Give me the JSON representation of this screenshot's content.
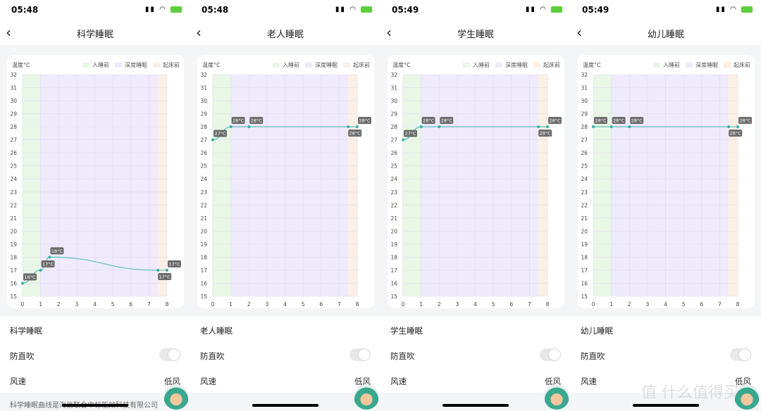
{
  "colors": {
    "line": "#5bbfba",
    "point": "#3aaea6",
    "pre_sleep": "#e9f7e6",
    "deep_sleep": "#efeafc",
    "pre_wake": "#fcefe4",
    "label_bg": "#6b6b6b"
  },
  "panels": [
    {
      "status_time": "05:48",
      "title": "科学睡眠",
      "unit_label": "温度°C",
      "legend": [
        "入睡前",
        "深度睡眠",
        "起床前"
      ],
      "mode_label": "科学睡眠",
      "anti_blow_label": "防直吹",
      "anti_blow_on": false,
      "wind_label": "风速",
      "wind_value": "低风",
      "footnote": "科学睡眠曲线是海信联合中标能效科技有限公司",
      "chart_data": {
        "type": "line",
        "x": [
          0,
          1,
          1.5,
          7.5,
          8
        ],
        "y": [
          16,
          17,
          18,
          17,
          17
        ],
        "point_labels": [
          "16°C",
          "17°C",
          "18°C",
          "17°C",
          "17°C"
        ],
        "xlim": [
          0,
          8
        ],
        "ylim": [
          15,
          32
        ],
        "xticks": [
          0,
          1,
          2,
          3,
          4,
          5,
          6,
          7,
          8
        ],
        "yticks": [
          15,
          16,
          17,
          18,
          19,
          20,
          21,
          22,
          23,
          24,
          25,
          26,
          27,
          28,
          29,
          30,
          31,
          32
        ],
        "bands": [
          {
            "name": "入睡前",
            "from": 0,
            "to": 1
          },
          {
            "name": "深度睡眠",
            "from": 1,
            "to": 7.5
          },
          {
            "name": "起床前",
            "from": 7.5,
            "to": 8
          }
        ],
        "grid": true,
        "legend": "top-right"
      }
    },
    {
      "status_time": "05:48",
      "title": "老人睡眠",
      "unit_label": "温度°C",
      "legend": [
        "入睡前",
        "深度睡眠",
        "起床前"
      ],
      "mode_label": "老人睡眠",
      "anti_blow_label": "防直吹",
      "anti_blow_on": false,
      "wind_label": "风速",
      "wind_value": "低风",
      "chart_data": {
        "type": "line",
        "x": [
          0,
          1,
          2,
          7.5,
          8
        ],
        "y": [
          27,
          28,
          28,
          28,
          28
        ],
        "point_labels": [
          "27°C",
          "28°C",
          "28°C",
          "28°C",
          "28°C"
        ],
        "xlim": [
          0,
          8
        ],
        "ylim": [
          15,
          32
        ],
        "xticks": [
          0,
          1,
          2,
          3,
          4,
          5,
          6,
          7,
          8
        ],
        "yticks": [
          15,
          16,
          17,
          18,
          19,
          20,
          21,
          22,
          23,
          24,
          25,
          26,
          27,
          28,
          29,
          30,
          31,
          32
        ],
        "bands": [
          {
            "name": "入睡前",
            "from": 0,
            "to": 1
          },
          {
            "name": "深度睡眠",
            "from": 1,
            "to": 7.5
          },
          {
            "name": "起床前",
            "from": 7.5,
            "to": 8
          }
        ],
        "grid": true,
        "legend": "top-right"
      }
    },
    {
      "status_time": "05:49",
      "title": "学生睡眠",
      "unit_label": "温度°C",
      "legend": [
        "入睡前",
        "深度睡眠",
        "起床前"
      ],
      "mode_label": "学生睡眠",
      "anti_blow_label": "防直吹",
      "anti_blow_on": false,
      "wind_label": "风速",
      "wind_value": "低风",
      "chart_data": {
        "type": "line",
        "x": [
          0,
          1,
          2,
          7.5,
          8
        ],
        "y": [
          27,
          28,
          28,
          28,
          28
        ],
        "point_labels": [
          "27°C",
          "28°C",
          "28°C",
          "28°C",
          "28°C"
        ],
        "xlim": [
          0,
          8
        ],
        "ylim": [
          15,
          32
        ],
        "xticks": [
          0,
          1,
          2,
          3,
          4,
          5,
          6,
          7,
          8
        ],
        "yticks": [
          15,
          16,
          17,
          18,
          19,
          20,
          21,
          22,
          23,
          24,
          25,
          26,
          27,
          28,
          29,
          30,
          31,
          32
        ],
        "bands": [
          {
            "name": "入睡前",
            "from": 0,
            "to": 1
          },
          {
            "name": "深度睡眠",
            "from": 1,
            "to": 7.5
          },
          {
            "name": "起床前",
            "from": 7.5,
            "to": 8
          }
        ],
        "grid": true,
        "legend": "top-right"
      }
    },
    {
      "status_time": "05:49",
      "title": "幼儿睡眠",
      "unit_label": "温度°C",
      "legend": [
        "入睡前",
        "深度睡眠",
        "起床前"
      ],
      "mode_label": "幼儿睡眠",
      "anti_blow_label": "防直吹",
      "anti_blow_on": false,
      "wind_label": "风速",
      "wind_value": "低风",
      "watermark": "值 什么值得买",
      "chart_data": {
        "type": "line",
        "x": [
          0,
          1,
          2,
          7.5,
          8
        ],
        "y": [
          28,
          28,
          28,
          28,
          28
        ],
        "point_labels": [
          "28°C",
          "28°C",
          "28°C",
          "28°C",
          "28°C"
        ],
        "xlim": [
          0,
          8
        ],
        "ylim": [
          15,
          32
        ],
        "xticks": [
          0,
          1,
          2,
          3,
          4,
          5,
          6,
          7,
          8
        ],
        "yticks": [
          15,
          16,
          17,
          18,
          19,
          20,
          21,
          22,
          23,
          24,
          25,
          26,
          27,
          28,
          29,
          30,
          31,
          32
        ],
        "bands": [
          {
            "name": "入睡前",
            "from": 0,
            "to": 1
          },
          {
            "name": "深度睡眠",
            "from": 1,
            "to": 7.5
          },
          {
            "name": "起床前",
            "from": 7.5,
            "to": 8
          }
        ],
        "grid": true,
        "legend": "top-right"
      }
    }
  ]
}
